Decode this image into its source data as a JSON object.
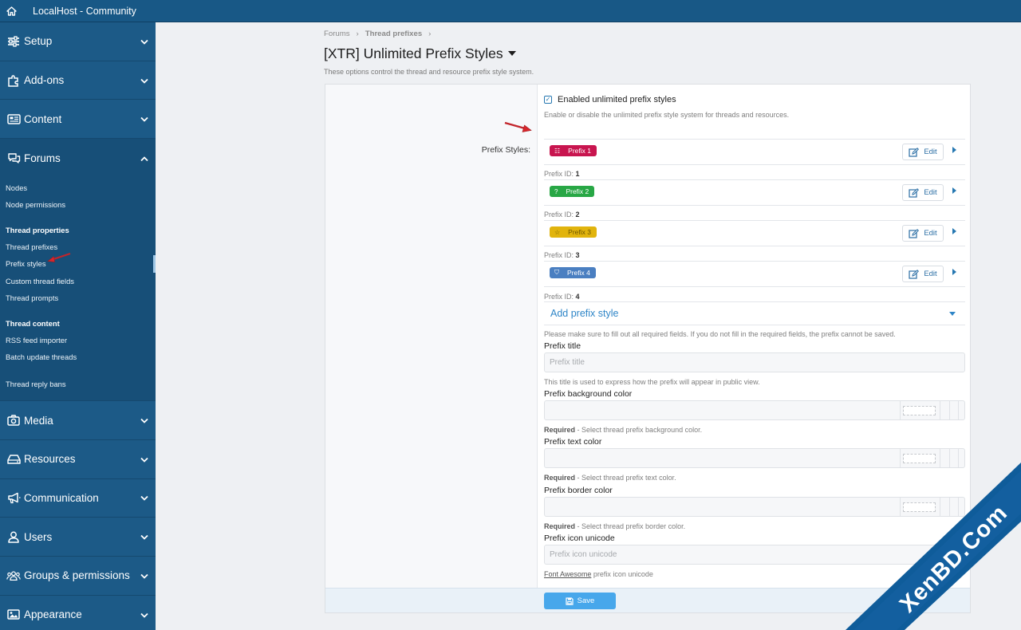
{
  "topbar": {
    "title": "LocalHost - Community"
  },
  "sidebar": {
    "sections_top": [
      {
        "label": "Setup",
        "icon": "sliders-icon"
      },
      {
        "label": "Add-ons",
        "icon": "puzzle-icon"
      },
      {
        "label": "Content",
        "icon": "newspaper-icon"
      }
    ],
    "forums": {
      "label": "Forums",
      "items": [
        "Nodes",
        "Node permissions"
      ],
      "group1": "Thread properties",
      "group1_items": [
        "Thread prefixes",
        "Prefix styles",
        "Custom thread fields",
        "Thread prompts"
      ],
      "group2": "Thread content",
      "group2_items": [
        "RSS feed importer",
        "Batch update threads",
        "Thread reply bans"
      ]
    },
    "sections_bottom": [
      {
        "label": "Media",
        "icon": "camera-icon"
      },
      {
        "label": "Resources",
        "icon": "drive-icon"
      },
      {
        "label": "Communication",
        "icon": "megaphone-icon"
      },
      {
        "label": "Users",
        "icon": "user-icon"
      },
      {
        "label": "Groups & permissions",
        "icon": "users-icon"
      },
      {
        "label": "Appearance",
        "icon": "image-icon"
      }
    ]
  },
  "breadcrumb": {
    "first": "Forums",
    "second": "Thread prefixes"
  },
  "page": {
    "title": "[XTR] Unlimited Prefix Styles",
    "description": "These options control the thread and resource prefix style system."
  },
  "form": {
    "enable_label": "Enabled unlimited prefix styles",
    "enable_hint": "Enable or disable the unlimited prefix style system for threads and resources.",
    "prefix_styles_label": "Prefix Styles:",
    "edit_label": "Edit",
    "prefix_id_label": "Prefix ID:",
    "prefixes": [
      {
        "name": "Prefix 1",
        "id": "1",
        "bg": "#c8154f",
        "fg": "#ffffff",
        "icon": "ticket-icon"
      },
      {
        "name": "Prefix 2",
        "id": "2",
        "bg": "#28a745",
        "fg": "#ffffff",
        "icon": "question-icon"
      },
      {
        "name": "Prefix 3",
        "id": "3",
        "bg": "#e1b40d",
        "fg": "#6b5500",
        "icon": "star-icon"
      },
      {
        "name": "Prefix 4",
        "id": "4",
        "bg": "#4a7fc1",
        "fg": "#ffffff",
        "icon": "shield-icon"
      }
    ],
    "add_prefix_style": "Add prefix style",
    "required_note": "Please make sure to fill out all required fields. If you do not fill in the required fields, the prefix cannot be saved.",
    "title_label": "Prefix title",
    "title_placeholder": "Prefix title",
    "title_hint": "This title is used to express how the prefix will appear in public view.",
    "bg_label": "Prefix background color",
    "bg_hint_strong": "Required",
    "bg_hint": " - Select thread prefix background color.",
    "text_label": "Prefix text color",
    "text_hint_strong": "Required",
    "text_hint": " - Select thread prefix text color.",
    "border_label": "Prefix border color",
    "border_hint_strong": "Required",
    "border_hint": " - Select thread prefix border color.",
    "icon_label": "Prefix icon unicode",
    "icon_placeholder": "Prefix icon unicode",
    "icon_hint_link": "Font Awesome",
    "icon_hint": " prefix icon unicode",
    "save_label": "Save"
  },
  "watermark": {
    "text": "XenBD.Com"
  }
}
